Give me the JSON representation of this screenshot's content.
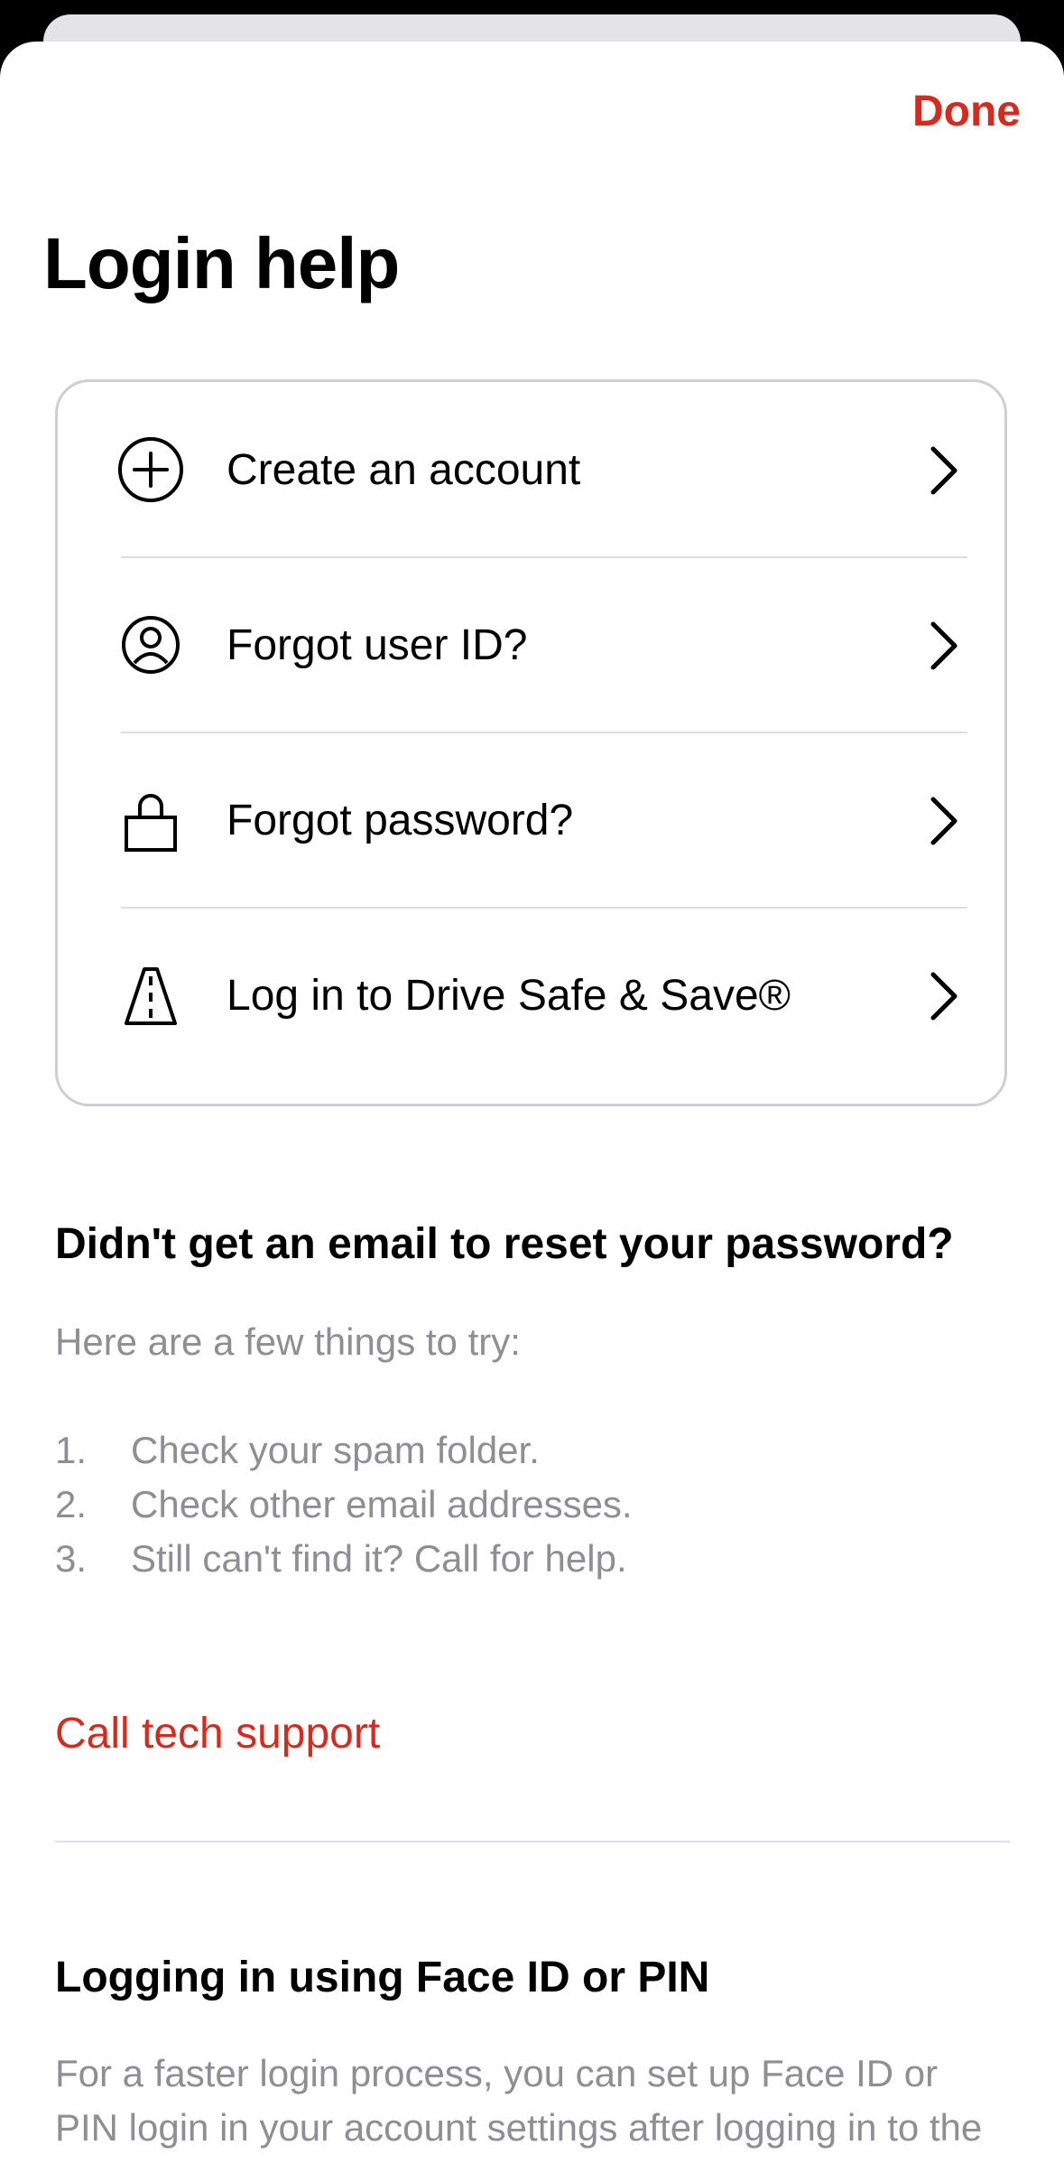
{
  "header": {
    "done_label": "Done",
    "title": "Login help"
  },
  "options": [
    {
      "label": "Create an account",
      "icon": "plus-circle-icon"
    },
    {
      "label": "Forgot user ID?",
      "icon": "user-circle-icon"
    },
    {
      "label": "Forgot password?",
      "icon": "lock-icon"
    },
    {
      "label": "Log in to Drive Safe & Save®",
      "icon": "road-icon"
    }
  ],
  "email_help": {
    "heading": "Didn't get an email to reset your password?",
    "intro": "Here are a few things to try:",
    "steps": [
      {
        "num": "1.",
        "text": "Check your spam folder."
      },
      {
        "num": "2.",
        "text": "Check other email addresses."
      },
      {
        "num": "3.",
        "text": "Still can't find it? Call for help."
      }
    ],
    "call_link": "Call tech support"
  },
  "faceid_help": {
    "heading": "Logging in using Face ID or PIN",
    "text": "For a faster login process, you can set up Face ID or PIN login in your account settings after logging in to the app."
  },
  "colors": {
    "accent": "#d42b1e",
    "secondary_text": "#8e8e93",
    "card_border": "#cfcfd3"
  }
}
